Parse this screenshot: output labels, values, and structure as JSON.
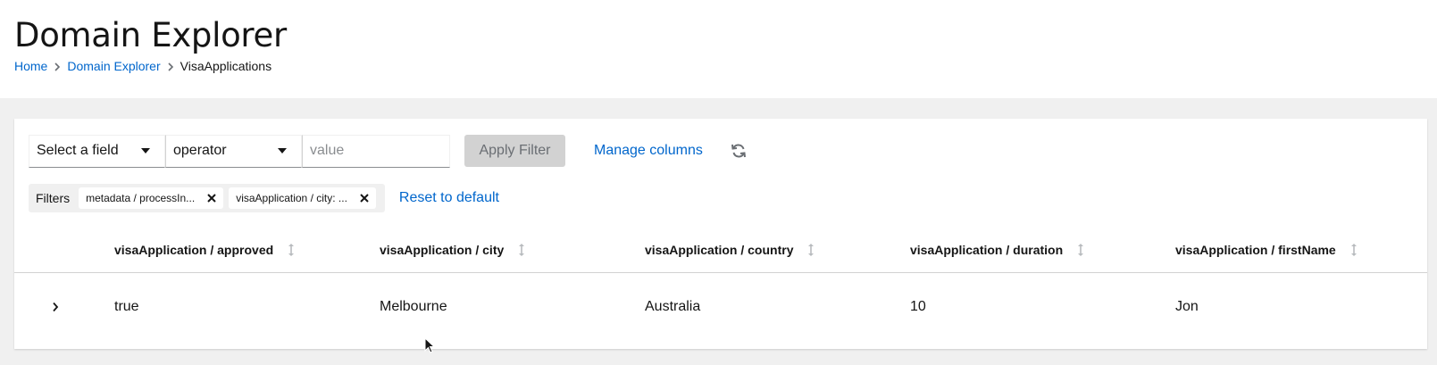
{
  "header": {
    "title": "Domain Explorer",
    "breadcrumb": [
      {
        "label": "Home"
      },
      {
        "label": "Domain Explorer"
      },
      {
        "label": "VisaApplications"
      }
    ]
  },
  "toolbar": {
    "field_select": "Select a field",
    "operator_select": "operator",
    "value_placeholder": "value",
    "apply_label": "Apply Filter",
    "manage_columns": "Manage columns",
    "refresh_icon": "refresh-icon"
  },
  "filters": {
    "label": "Filters",
    "chips": [
      {
        "label": "metadata / processIn..."
      },
      {
        "label": "visaApplication / city: ..."
      }
    ],
    "reset_label": "Reset to default"
  },
  "table": {
    "columns": [
      "visaApplication / approved",
      "visaApplication / city",
      "visaApplication / country",
      "visaApplication / duration",
      "visaApplication / firstName"
    ],
    "rows": [
      [
        "true",
        "Melbourne",
        "Australia",
        "10",
        "Jon"
      ]
    ]
  },
  "colors": {
    "link": "#0066cc",
    "text": "#151515",
    "background": "#f0f0f0"
  }
}
